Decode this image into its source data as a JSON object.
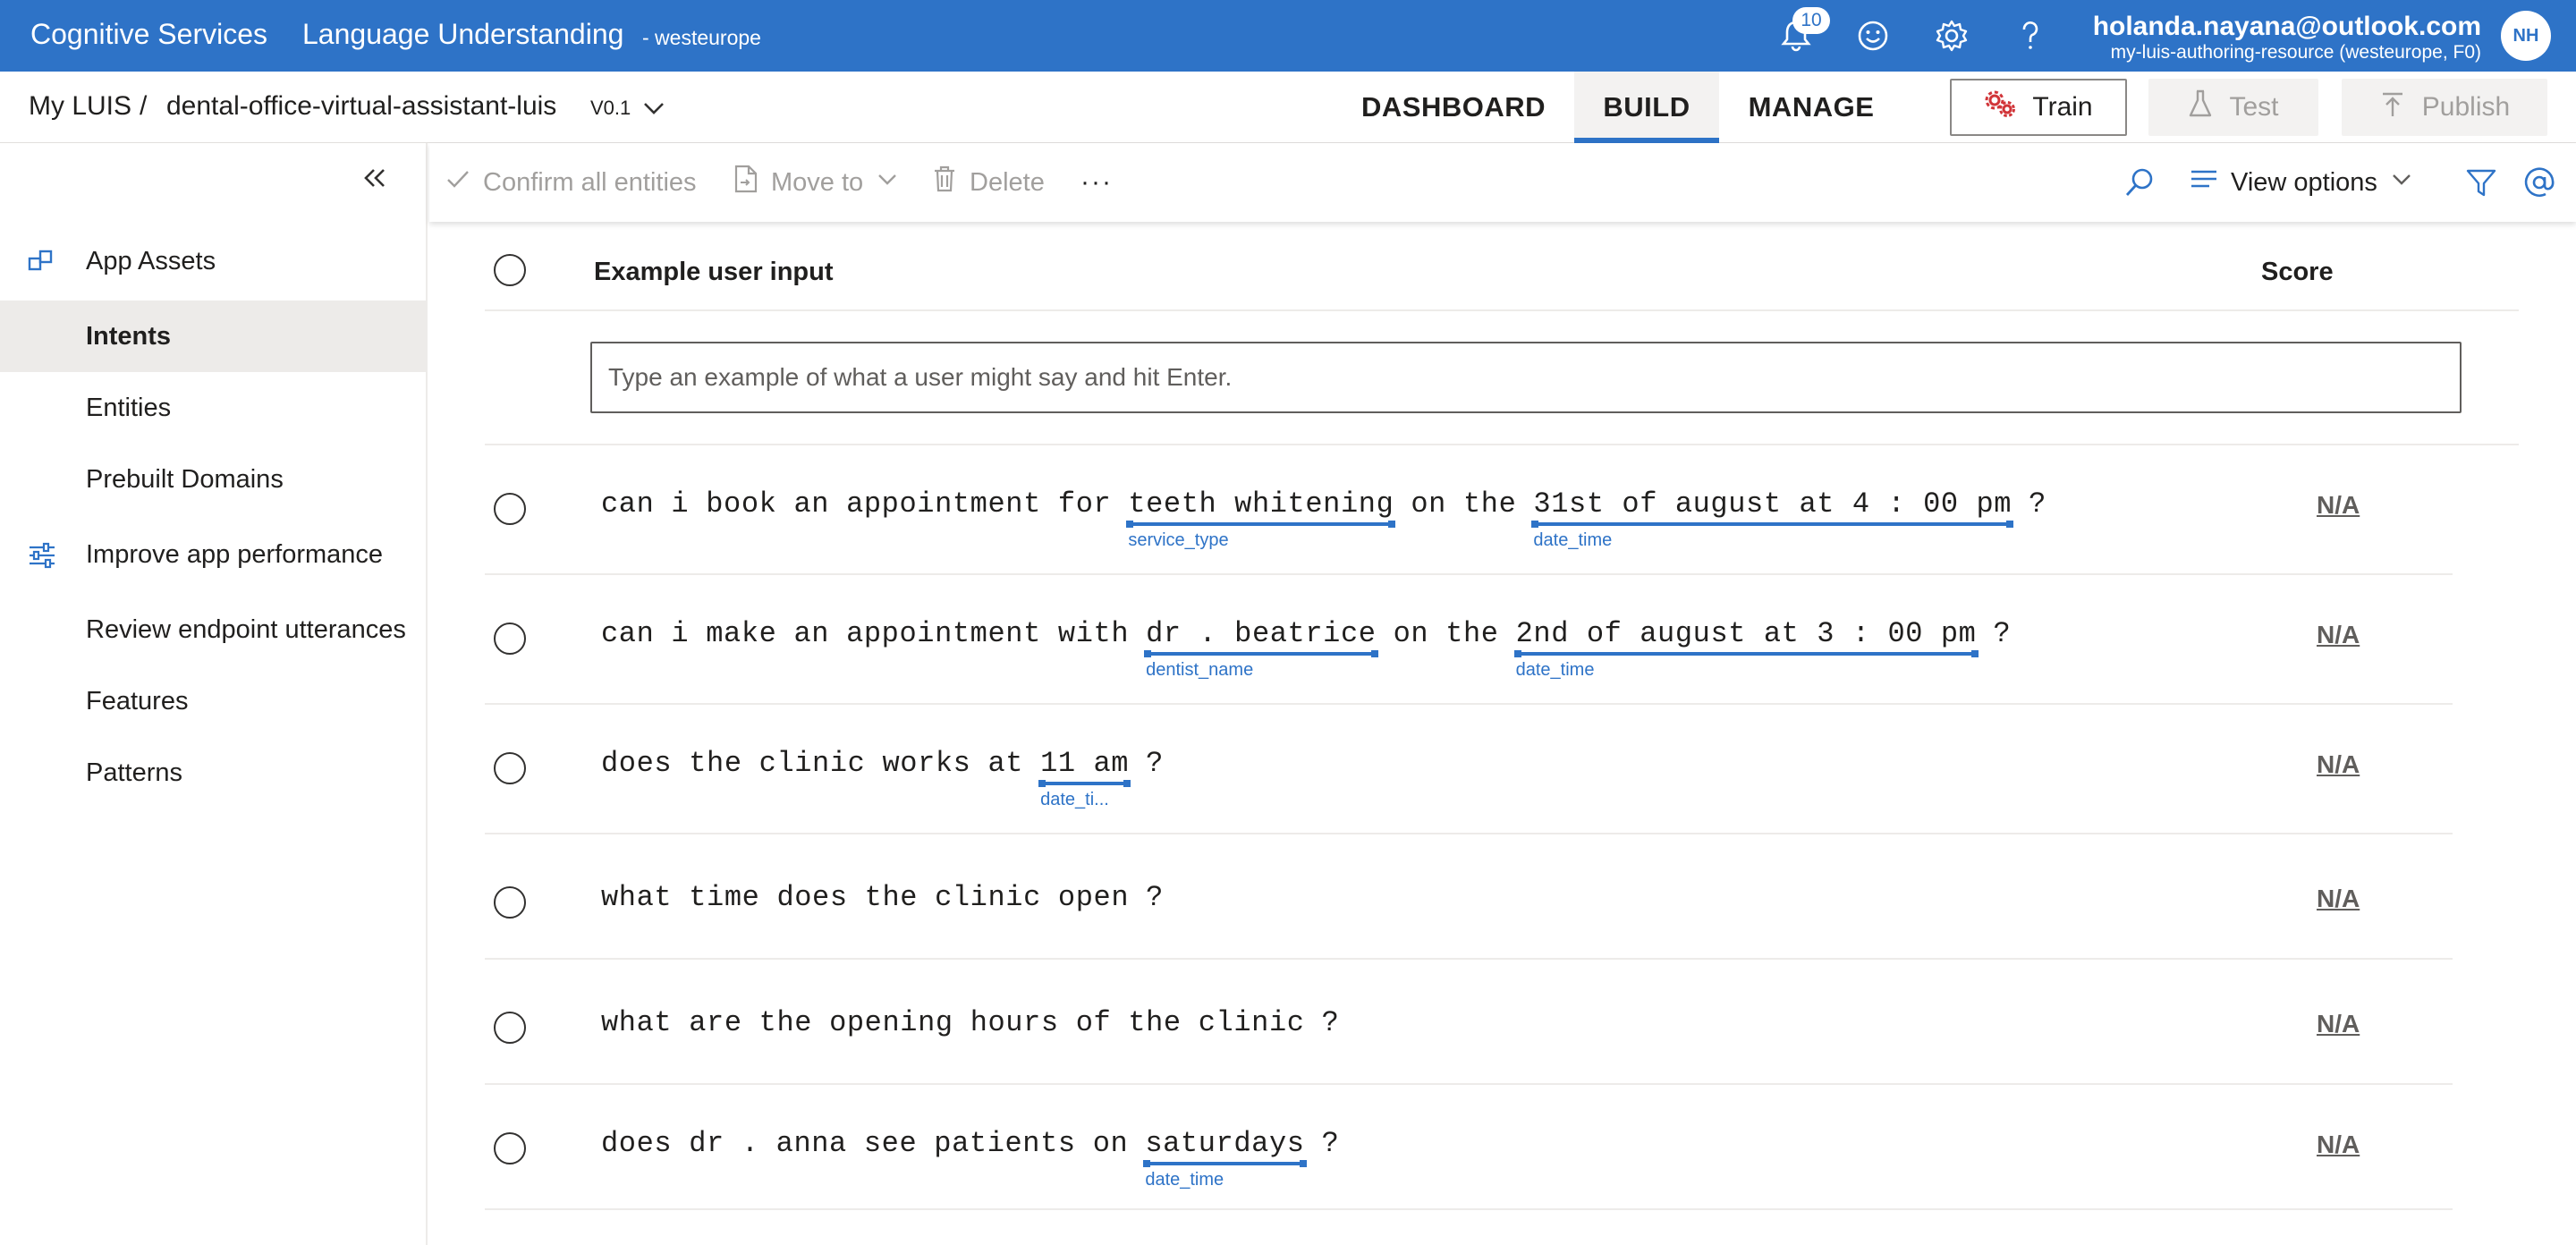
{
  "topbar": {
    "brand": "Cognitive Services",
    "product": "Language Understanding",
    "region": "- westeurope",
    "notifications_count": "10",
    "icons": [
      "bell-icon",
      "smiley-icon",
      "gear-icon",
      "help-icon"
    ],
    "user_email": "holanda.nayana@outlook.com",
    "user_resource": "my-luis-authoring-resource (westeurope, F0)",
    "avatar_initials": "NH"
  },
  "appbar": {
    "crumb_root": "My LUIS",
    "crumb_sep": "/",
    "app_name": "dental-office-virtual-assistant-luis",
    "version": "V0.1",
    "tabs": [
      {
        "label": "DASHBOARD",
        "active": false
      },
      {
        "label": "BUILD",
        "active": true
      },
      {
        "label": "MANAGE",
        "active": false
      }
    ],
    "train_label": "Train",
    "test_label": "Test",
    "publish_label": "Publish"
  },
  "sidebar": {
    "items": [
      {
        "label": "App Assets",
        "icon": "app-assets-icon"
      },
      {
        "label": "Intents",
        "active": true
      },
      {
        "label": "Entities"
      },
      {
        "label": "Prebuilt Domains"
      },
      {
        "label": "Improve app performance",
        "icon": "sliders-icon"
      },
      {
        "label": "Review endpoint utterances"
      },
      {
        "label": "Features"
      },
      {
        "label": "Patterns"
      }
    ]
  },
  "toolbar": {
    "confirm_label": "Confirm all entities",
    "move_label": "Move to",
    "delete_label": "Delete",
    "more_label": "···",
    "view_options_label": "View options"
  },
  "grid": {
    "col_input": "Example user input",
    "col_score": "Score",
    "input_placeholder": "Type an example of what a user might say and hit Enter.",
    "utterances": [
      {
        "segments": [
          {
            "text": "can"
          },
          {
            "text": "i"
          },
          {
            "text": "book"
          },
          {
            "text": "an"
          },
          {
            "text": "appointment"
          },
          {
            "text": "for"
          },
          {
            "text": "teeth whitening",
            "entity": "service_type"
          },
          {
            "text": "on"
          },
          {
            "text": "the"
          },
          {
            "text": "31st of august at 4 : 00 pm",
            "entity": "date_time"
          },
          {
            "text": "?"
          }
        ],
        "score": "N/A"
      },
      {
        "segments": [
          {
            "text": "can"
          },
          {
            "text": "i"
          },
          {
            "text": "make"
          },
          {
            "text": "an"
          },
          {
            "text": "appointment"
          },
          {
            "text": "with"
          },
          {
            "text": "dr . beatrice",
            "entity": "dentist_name"
          },
          {
            "text": "on"
          },
          {
            "text": "the"
          },
          {
            "text": "2nd of august at 3 : 00 pm",
            "entity": "date_time"
          },
          {
            "text": "?"
          }
        ],
        "score": "N/A"
      },
      {
        "segments": [
          {
            "text": "does"
          },
          {
            "text": "the"
          },
          {
            "text": "clinic"
          },
          {
            "text": "works"
          },
          {
            "text": "at"
          },
          {
            "text": "11 am",
            "entity": "date_ti..."
          },
          {
            "text": "?"
          }
        ],
        "score": "N/A"
      },
      {
        "segments": [
          {
            "text": "what"
          },
          {
            "text": "time"
          },
          {
            "text": "does"
          },
          {
            "text": "the"
          },
          {
            "text": "clinic"
          },
          {
            "text": "open"
          },
          {
            "text": "?"
          }
        ],
        "score": "N/A"
      },
      {
        "segments": [
          {
            "text": "what"
          },
          {
            "text": "are"
          },
          {
            "text": "the"
          },
          {
            "text": "opening"
          },
          {
            "text": "hours"
          },
          {
            "text": "of"
          },
          {
            "text": "the"
          },
          {
            "text": "clinic"
          },
          {
            "text": "?"
          }
        ],
        "score": "N/A"
      },
      {
        "segments": [
          {
            "text": "does"
          },
          {
            "text": "dr"
          },
          {
            "text": "."
          },
          {
            "text": "anna"
          },
          {
            "text": "see"
          },
          {
            "text": "patients"
          },
          {
            "text": "on"
          },
          {
            "text": "saturdays",
            "entity": "date_time"
          },
          {
            "text": "?"
          }
        ],
        "score": "N/A"
      }
    ]
  },
  "colors": {
    "accent": "#2e73c7",
    "sidebar_active": "#edebe9"
  }
}
